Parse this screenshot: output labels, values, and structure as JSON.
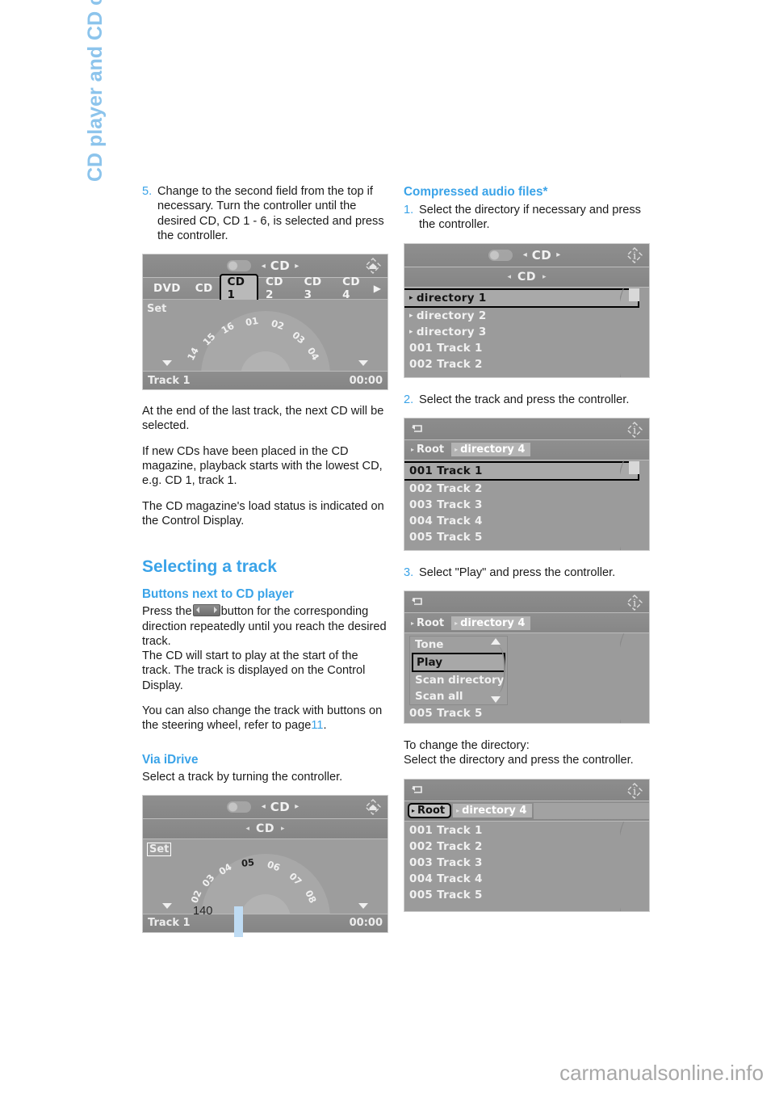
{
  "chapter": {
    "title": "CD player and CD changer",
    "accent": "#8cc4ec"
  },
  "page": {
    "number": "140",
    "watermark": "carmanualsonline.info"
  },
  "left_column": {
    "step5": {
      "num": "5.",
      "text": "Change to the second field from the top if necessary. Turn the controller until the desired CD, CD 1 - 6, is selected and press the controller."
    },
    "para1": "At the end of the last track, the next CD will be selected.",
    "para2": "If new CDs have been placed in the CD magazine, playback starts with the lowest CD, e.g. CD 1, track 1.",
    "para3": "The CD magazine's load status is indicated on the Control Display.",
    "heading_selecting": "Selecting a track",
    "heading_buttons": "Buttons next to CD player",
    "buttons_text_before": "Press the",
    "buttons_text_after": "button for the corresponding direction repeatedly until you reach the desired track.",
    "buttons_text_2": "The CD will start to play at the start of the track. The track is displayed on the Control Display.",
    "buttons_text_3_a": "You can also change the track with buttons on the steering wheel, refer to page",
    "buttons_text_3_page": "11",
    "buttons_text_3_b": ".",
    "heading_idrive": "Via iDrive",
    "idrive_text": "Select a track by turning the controller."
  },
  "right_column": {
    "heading_compressed": "Compressed audio files*",
    "step1": {
      "num": "1.",
      "text": "Select the directory if necessary and press the controller."
    },
    "step2": {
      "num": "2.",
      "text": "Select the track and press the controller."
    },
    "step3": {
      "num": "3.",
      "text": "Select \"Play\" and press the controller."
    },
    "change_dir_line1": "To change the directory:",
    "change_dir_line2": "Select the directory and press the controller."
  },
  "screens": {
    "cd_changer": {
      "topbar": {
        "label": "CD",
        "left_arrow": "◂",
        "right_arrow": "▸",
        "corner_icon": "home-diamond-icon"
      },
      "tabs": [
        {
          "label": "DVD",
          "selected": false
        },
        {
          "label": "CD",
          "selected": false
        },
        {
          "label": "CD 1",
          "selected": true
        },
        {
          "label": "CD 2",
          "selected": false
        },
        {
          "label": "CD 3",
          "selected": false
        },
        {
          "label": "CD 4",
          "selected": false
        }
      ],
      "next_arrow": "▶",
      "set_label": "Set",
      "dial_numbers": [
        "14",
        "15",
        "16",
        "01",
        "02",
        "03",
        "04"
      ],
      "dial_current": "",
      "bottom_left": "Track 1",
      "bottom_right": "00:00"
    },
    "cd_track_dial": {
      "topbar": {
        "label": "CD",
        "left_arrow": "◂",
        "right_arrow": "▸",
        "corner_icon": "home-diamond-icon"
      },
      "subbar": {
        "label": "CD",
        "left_arrow": "◂",
        "right_arrow": "▸"
      },
      "set_label": "Set",
      "dial_numbers": [
        "02",
        "03",
        "04",
        "05",
        "06",
        "07",
        "08"
      ],
      "dial_current": "05",
      "bottom_left": "Track 1",
      "bottom_right": "00:00"
    },
    "directory_list": {
      "topbar": {
        "label": "CD",
        "left_arrow": "◂",
        "right_arrow": "▸",
        "corner_icon": "info-diamond-icon"
      },
      "subbar": {
        "label": "CD",
        "left_arrow": "◂",
        "right_arrow": "▸"
      },
      "rows": [
        {
          "label": "directory 1",
          "has_arrow": true,
          "selected": true
        },
        {
          "label": "directory 2",
          "has_arrow": true,
          "selected": false
        },
        {
          "label": "directory 3",
          "has_arrow": true,
          "selected": false
        },
        {
          "label": "001 Track  1",
          "has_arrow": false,
          "selected": false
        },
        {
          "label": "002 Track  2",
          "has_arrow": false,
          "selected": false
        }
      ]
    },
    "track_list": {
      "topbar": {
        "back_icon": "back-arrow-icon",
        "corner_icon": "info-diamond-icon"
      },
      "crumbs": [
        {
          "label": "Root",
          "state": "normal"
        },
        {
          "label": "directory 4",
          "state": "active"
        }
      ],
      "rows": [
        {
          "label": "001 Track  1",
          "selected": true
        },
        {
          "label": "002 Track  2",
          "selected": false
        },
        {
          "label": "003 Track  3",
          "selected": false
        },
        {
          "label": "004 Track  4",
          "selected": false
        },
        {
          "label": "005 Track  5",
          "selected": false
        }
      ]
    },
    "play_menu": {
      "topbar": {
        "back_icon": "back-arrow-icon",
        "corner_icon": "info-diamond-icon"
      },
      "crumbs": [
        {
          "label": "Root",
          "state": "normal"
        },
        {
          "label": "directory 4",
          "state": "active"
        }
      ],
      "menu": [
        {
          "label": "Tone",
          "selected": false
        },
        {
          "label": "Play",
          "selected": true
        },
        {
          "label": "Scan directory",
          "selected": false
        },
        {
          "label": "Scan all",
          "selected": false
        }
      ],
      "bottom_row": "005 Track  5"
    },
    "root_selected": {
      "topbar": {
        "back_icon": "back-arrow-icon",
        "corner_icon": "info-diamond-icon"
      },
      "crumbs": [
        {
          "label": "Root",
          "state": "selected"
        },
        {
          "label": "directory 4",
          "state": "active"
        },
        {
          "label": "",
          "state": "blank"
        }
      ],
      "rows": [
        {
          "label": "001 Track  1",
          "selected": false
        },
        {
          "label": "002 Track  2",
          "selected": false
        },
        {
          "label": "003 Track  3",
          "selected": false
        },
        {
          "label": "004 Track  4",
          "selected": false
        },
        {
          "label": "005 Track  5",
          "selected": false
        }
      ]
    }
  }
}
